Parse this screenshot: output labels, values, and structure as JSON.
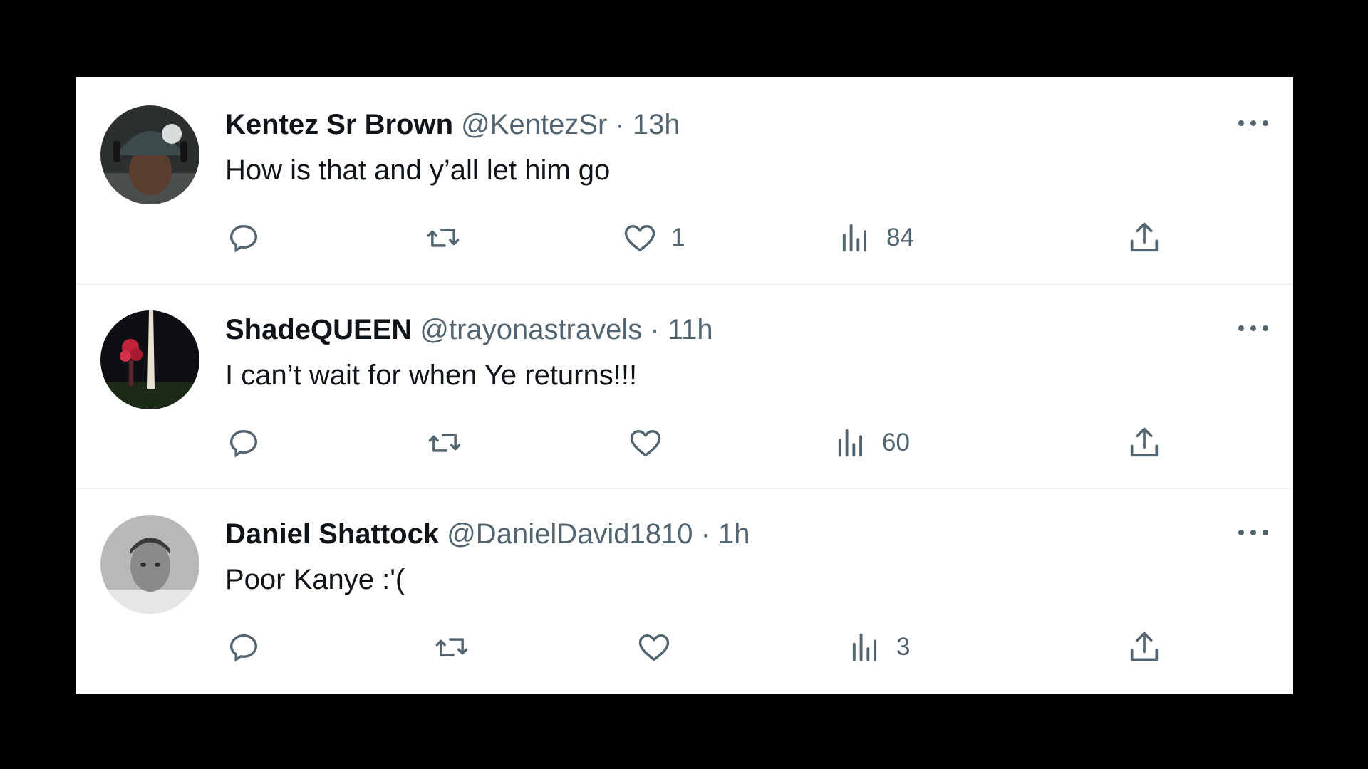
{
  "colors": {
    "background": "#000000",
    "panel": "#ffffff",
    "text_primary": "#0f1419",
    "text_secondary": "#536471",
    "divider": "#eff3f4"
  },
  "tweets": [
    {
      "name": "Kentez Sr Brown",
      "handle": "@KentezSr",
      "separator": "·",
      "time": "13h",
      "text": "How is that and y’all let him go",
      "avatar_icon": "user-avatar-beanie",
      "reply_count": "",
      "retweet_count": "",
      "like_count": "1",
      "view_count": "84"
    },
    {
      "name": "ShadeQUEEN",
      "handle": "@trayonastravels",
      "separator": "·",
      "time": "11h",
      "text": "I can’t wait for when Ye returns!!!",
      "avatar_icon": "user-avatar-monument-night",
      "reply_count": "",
      "retweet_count": "",
      "like_count": "",
      "view_count": "60"
    },
    {
      "name": "Daniel Shattock",
      "handle": "@DanielDavid1810",
      "separator": "·",
      "time": "1h",
      "text": "Poor Kanye :'(",
      "avatar_icon": "user-avatar-grayscale",
      "reply_count": "",
      "retweet_count": "",
      "like_count": "",
      "view_count": "3"
    }
  ],
  "icons": {
    "reply": "reply-icon",
    "retweet": "retweet-icon",
    "like": "heart-icon",
    "views": "views-chart-icon",
    "share": "share-icon",
    "more": "more-dots-icon"
  }
}
